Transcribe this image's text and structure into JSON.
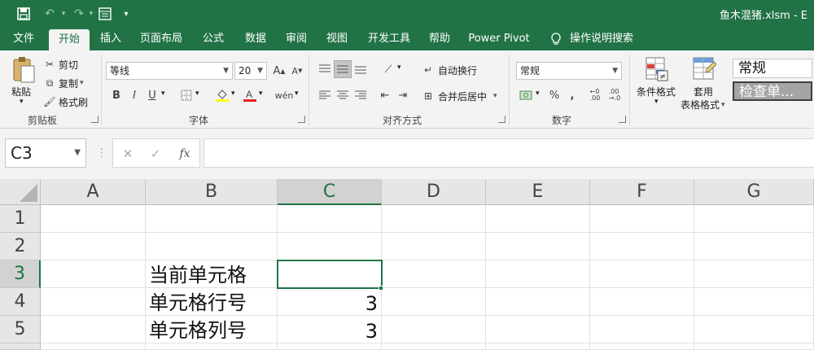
{
  "app": {
    "title": "鱼木混猪.xlsm - E",
    "accent_color": "#217346"
  },
  "quick_access": {
    "save_icon": "save-icon",
    "undo_icon": "undo-icon",
    "redo_icon": "redo-icon",
    "form_icon": "form-icon",
    "customize_icon": "customize-icon"
  },
  "menu": {
    "tabs": [
      "文件",
      "开始",
      "插入",
      "页面布局",
      "公式",
      "数据",
      "审阅",
      "视图",
      "开发工具",
      "帮助",
      "Power Pivot"
    ],
    "active_tab": "开始",
    "search_label": "操作说明搜索"
  },
  "ribbon": {
    "clipboard": {
      "paste": "粘贴",
      "cut": "剪切",
      "copy": "复制",
      "format_painter": "格式刷",
      "label": "剪贴板"
    },
    "font": {
      "font_name": "等线",
      "font_size": "20",
      "grow": "A",
      "shrink": "A",
      "bold": "B",
      "italic": "I",
      "underline": "U",
      "font_color_glyph": "A",
      "phonetic": "wén",
      "label": "字体"
    },
    "alignment": {
      "wrap_text": "自动换行",
      "merge_center": "合并后居中",
      "label": "对齐方式"
    },
    "number": {
      "format": "常规",
      "percent": "%",
      "comma": ",",
      "label": "数字"
    },
    "styles": {
      "conditional_format": "条件格式",
      "table_format_line1": "套用",
      "table_format_line2": "表格格式",
      "style_normal": "常规",
      "style_check": "检查单..."
    }
  },
  "formula_bar": {
    "name_box": "C3",
    "cancel": "✕",
    "enter": "✓",
    "fx": "fx",
    "formula": ""
  },
  "sheet": {
    "columns": [
      "A",
      "B",
      "C",
      "D",
      "E",
      "F",
      "G"
    ],
    "rows": [
      "1",
      "2",
      "3",
      "4",
      "5"
    ],
    "selected_column": "C",
    "selected_row": "3",
    "cells": {
      "B3": "当前单元格",
      "B4": "单元格行号",
      "C4": "3",
      "B5": "单元格列号",
      "C5": "3"
    }
  }
}
